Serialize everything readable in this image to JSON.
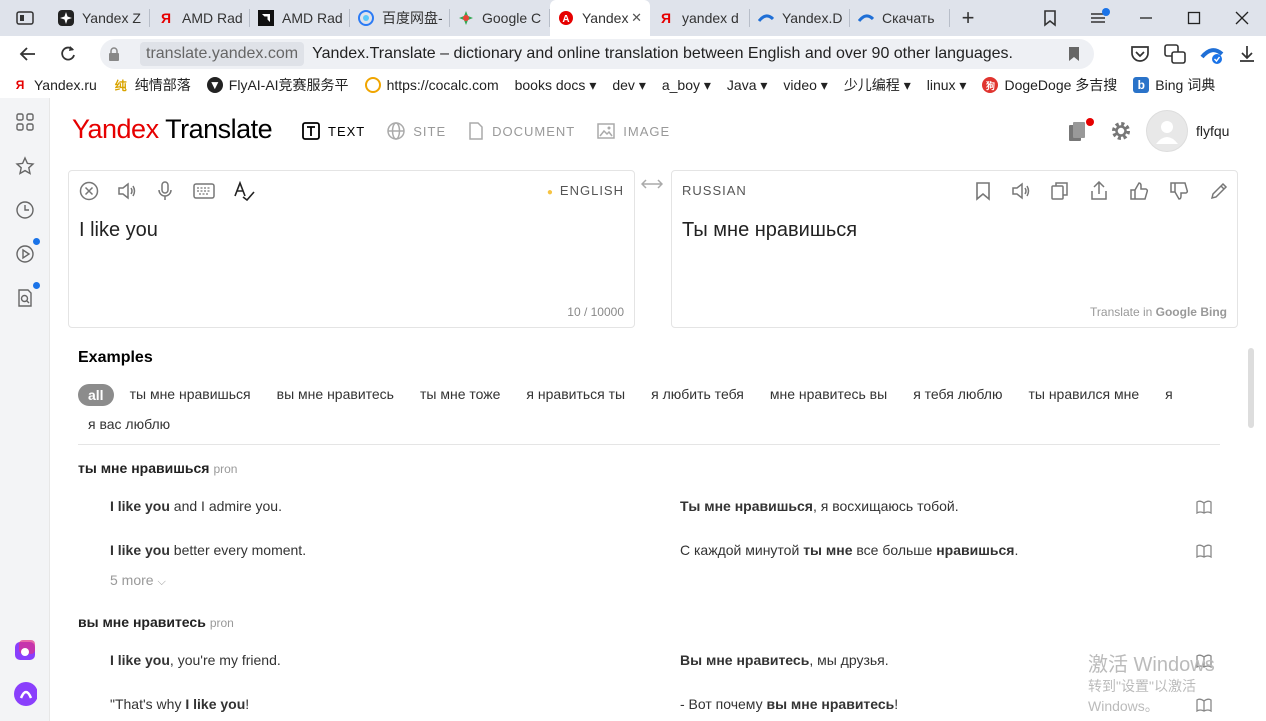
{
  "tabs": [
    {
      "label": "Yandex Z",
      "icon": "yandex-zen-icon"
    },
    {
      "label": "AMD Rad",
      "icon": "yandex-icon"
    },
    {
      "label": "AMD Rad",
      "icon": "amd-icon"
    },
    {
      "label": "百度网盘-",
      "icon": "baidu-netdisk-icon"
    },
    {
      "label": "Google C",
      "icon": "google-chrome-icon"
    },
    {
      "label": "Yandex",
      "icon": "yandex-translate-icon",
      "active": true
    },
    {
      "label": "yandex d",
      "icon": "yandex-icon"
    },
    {
      "label": "Yandex.D",
      "icon": "yandex-disk-icon"
    },
    {
      "label": "Скачать ",
      "icon": "yandex-disk-icon"
    }
  ],
  "address": {
    "domain": "translate.yandex.com",
    "title": "Yandex.Translate – dictionary and online translation between English and over 90 other languages."
  },
  "bookmarks": [
    {
      "label": "Yandex.ru",
      "icon": "yandex-icon"
    },
    {
      "label": "纯情部落",
      "icon": "chunqing-icon"
    },
    {
      "label": "FlyAI-AI竞赛服务平",
      "icon": "flyai-icon"
    },
    {
      "label": "https://cocalc.com",
      "icon": "cocalc-icon"
    },
    {
      "label": "books docs ▾",
      "icon": ""
    },
    {
      "label": "dev ▾",
      "icon": ""
    },
    {
      "label": "a_boy ▾",
      "icon": ""
    },
    {
      "label": "Java ▾",
      "icon": ""
    },
    {
      "label": "video ▾",
      "icon": ""
    },
    {
      "label": "少儿编程 ▾",
      "icon": ""
    },
    {
      "label": "linux ▾",
      "icon": ""
    },
    {
      "label": "DogeDoge 多吉搜",
      "icon": "dogedoge-icon"
    },
    {
      "label": "Bing 词典",
      "icon": "bing-icon"
    }
  ],
  "header": {
    "logo_yandex": "Yandex",
    "logo_translate": "Translate",
    "modes": [
      "TEXT",
      "SITE",
      "DOCUMENT",
      "IMAGE"
    ],
    "username": "flyfqu"
  },
  "source": {
    "lang": "ENGLISH",
    "text": "I like you",
    "counter": "10 / 10000"
  },
  "target": {
    "lang": "RUSSIAN",
    "text": "Ты мне нравишься",
    "translate_in": "Translate in",
    "engine1": "Google",
    "engine2": "Bing"
  },
  "examples": {
    "heading": "Examples",
    "chips": [
      "all",
      "ты мне нравишься",
      "вы мне нравитесь",
      "ты мне тоже",
      "я нравиться ты",
      "я любить тебя",
      "мне нравитесь вы",
      "я тебя люблю",
      "ты нравился мне",
      "я",
      "я вас люблю"
    ],
    "groups": [
      {
        "title": "ты мне нравишься",
        "pos": "pron",
        "rows": [
          {
            "en_b": "I like you",
            "en_rest": " and I admire you.",
            "ru_pre": "",
            "ru_b": "Ты мне нравишься",
            "ru_rest": ", я восхищаюсь тобой."
          },
          {
            "en_b": "I like you",
            "en_rest": " better every moment.",
            "ru_pre": "С каждой минутой ",
            "ru_b": "ты мне",
            "ru_mid": " все больше ",
            "ru_b2": "нравишься",
            "ru_rest": "."
          }
        ],
        "more": "5 more"
      },
      {
        "title": "вы мне нравитесь",
        "pos": "pron",
        "rows": [
          {
            "en_b": "I like you",
            "en_rest": ", you're my friend.",
            "ru_pre": "",
            "ru_b": "Вы мне нравитесь",
            "ru_rest": ", мы друзья."
          },
          {
            "en_pre": "\"That's why ",
            "en_b": "I like you",
            "en_rest": "!",
            "ru_pre": "- Вот почему ",
            "ru_b": "вы мне нравитесь",
            "ru_rest": "!"
          }
        ]
      }
    ]
  },
  "watermark": {
    "line1": "激活 Windows",
    "line2": "转到\"设置\"以激活 Windows。"
  },
  "colors": {
    "brand_red": "#e60000",
    "accent_blue": "#1a73e8"
  }
}
